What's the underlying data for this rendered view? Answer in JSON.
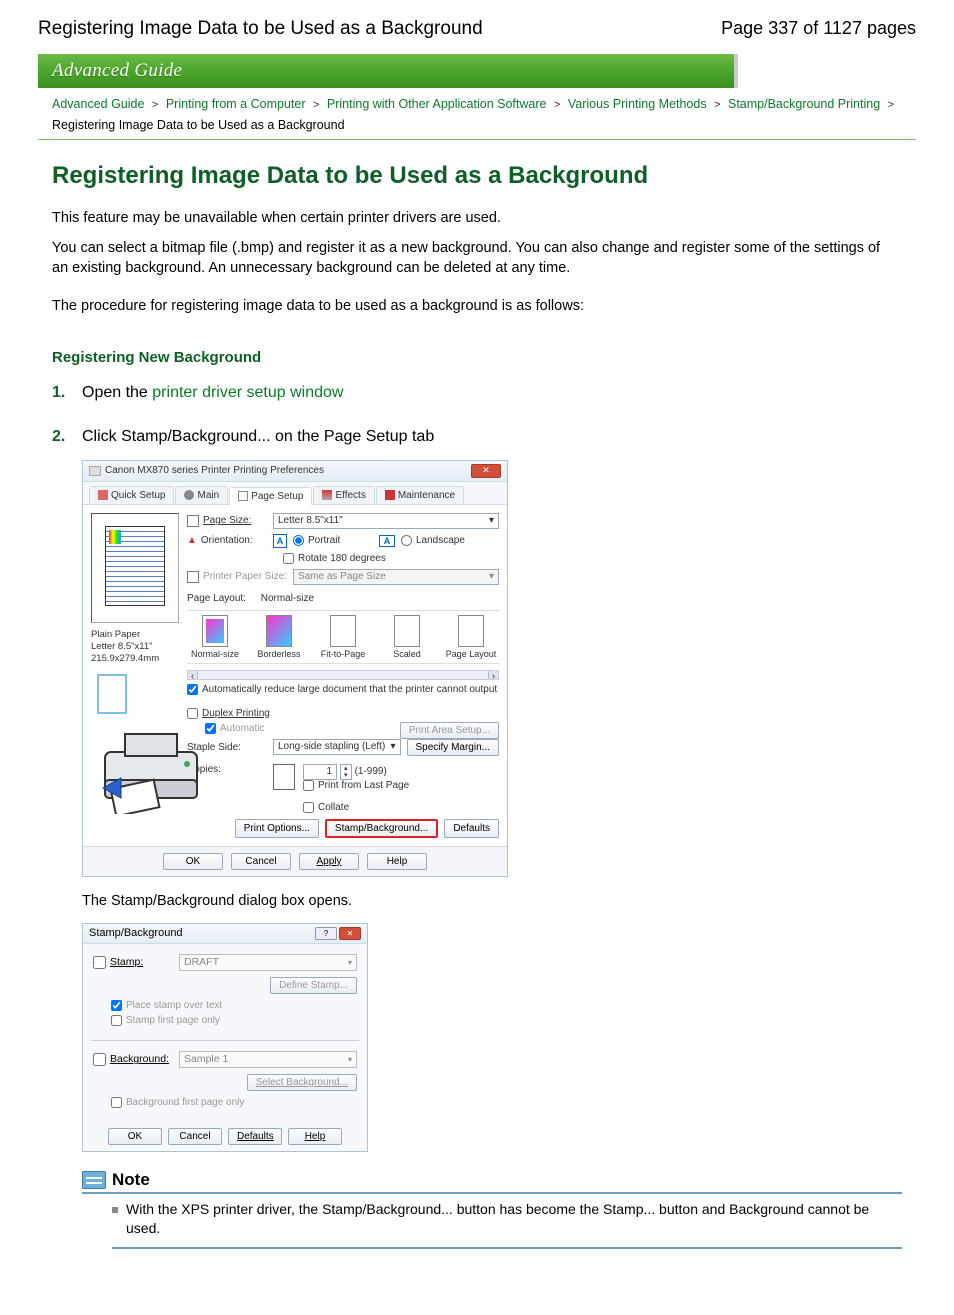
{
  "header": {
    "doc_title": "Registering Image Data to be Used as a Background",
    "page_indicator": "Page 337 of 1127 pages",
    "banner": "Advanced Guide"
  },
  "breadcrumb": {
    "items": [
      "Advanced Guide",
      "Printing from a Computer",
      "Printing with Other Application Software",
      "Various Printing Methods",
      "Stamp/Background Printing"
    ],
    "current": "Registering Image Data to be Used as a Background",
    "sep": ">"
  },
  "main": {
    "heading": "Registering Image Data to be Used as a Background",
    "para1": "This feature may be unavailable when certain printer drivers are used.",
    "para2": "You can select a bitmap file (.bmp) and register it as a new background. You can also change and register some of the settings of an existing background. An unnecessary background can be deleted at any time.",
    "para3": "The procedure for registering image data to be used as a background is as follows:"
  },
  "section_heading": "Registering New Background",
  "steps": {
    "s1": {
      "num": "1.",
      "prefix": "Open the ",
      "link": "printer driver setup window"
    },
    "s2": {
      "num": "2.",
      "text": "Click Stamp/Background... on the Page Setup tab",
      "followup": "The Stamp/Background dialog box opens."
    }
  },
  "dlg1": {
    "title": "Canon MX870 series Printer Printing Preferences",
    "tabs": [
      "Quick Setup",
      "Main",
      "Page Setup",
      "Effects",
      "Maintenance"
    ],
    "active_tab": 2,
    "labels": {
      "page_size": "Page Size:",
      "page_size_val": "Letter 8.5\"x11\"",
      "orientation": "Orientation:",
      "portrait": "Portrait",
      "landscape": "Landscape",
      "rotate": "Rotate 180 degrees",
      "printer_paper": "Printer Paper Size:",
      "printer_paper_val": "Same as Page Size",
      "page_layout_lbl": "Page Layout:",
      "page_layout_val": "Normal-size",
      "layouts": [
        "Normal-size",
        "Borderless",
        "Fit-to-Page",
        "Scaled",
        "Page Layout"
      ],
      "auto_reduce": "Automatically reduce large document that the printer cannot output",
      "duplex": "Duplex Printing",
      "automatic": "Automatic",
      "staple": "Staple Side:",
      "staple_val": "Long-side stapling (Left)",
      "print_area": "Print Area Setup...",
      "specify_margin": "Specify Margin...",
      "copies": "Copies:",
      "copies_val": "1",
      "copies_range": "(1-999)",
      "last_page": "Print from Last Page",
      "collate": "Collate",
      "print_options": "Print Options...",
      "stamp_bg": "Stamp/Background...",
      "defaults": "Defaults"
    },
    "paper_info": {
      "type": "Plain Paper",
      "size": "Letter 8.5\"x11\" 215.9x279.4mm"
    },
    "footer": {
      "ok": "OK",
      "cancel": "Cancel",
      "apply": "Apply",
      "help": "Help"
    }
  },
  "dlg2": {
    "title": "Stamp/Background",
    "stamp_lbl": "Stamp:",
    "stamp_val": "DRAFT",
    "define_stamp": "Define Stamp...",
    "place_over": "Place stamp over text",
    "first_page": "Stamp first page only",
    "bg_lbl": "Background:",
    "bg_val": "Sample 1",
    "select_bg": "Select Background...",
    "bg_first_page": "Background first page only",
    "ok": "OK",
    "cancel": "Cancel",
    "defaults": "Defaults",
    "help": "Help"
  },
  "note": {
    "heading": "Note",
    "item": "With the XPS printer driver, the Stamp/Background... button has become the Stamp... button and Background cannot be used."
  }
}
